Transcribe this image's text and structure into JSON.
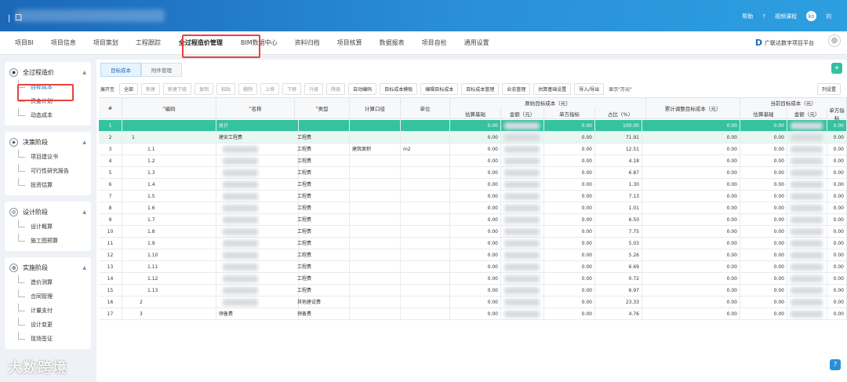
{
  "topbar": {
    "brand": "| 口",
    "help": "帮助",
    "video": "视频课程",
    "avatar": "ko",
    "user": "刘"
  },
  "nav": [
    "项目BI",
    "项目信息",
    "项目策划",
    "工程跟踪",
    "全过程造价管理",
    "BIM数据中心",
    "资料归档",
    "项目核算",
    "数据报表",
    "项目自检",
    "通用设置"
  ],
  "platform": "广联达数字项目平台",
  "sidebar": [
    {
      "title": "全过程造价",
      "items": [
        "目标成本",
        "资金计划",
        "动态成本"
      ]
    },
    {
      "title": "决策阶段",
      "items": [
        "项目建议书",
        "可行性研究报告",
        "投资估算"
      ]
    },
    {
      "title": "设计阶段",
      "items": [
        "设计概算",
        "施工图预算"
      ]
    },
    {
      "title": "实施阶段",
      "items": [
        "造价测算",
        "合同管理",
        "计量支付",
        "设计变更",
        "现场签证"
      ]
    }
  ],
  "tabs": [
    "目标成本",
    "附件管理"
  ],
  "toolbar": {
    "expand_label": "展开至",
    "expand_value": "全部",
    "buttons": [
      "新建",
      "新建下级",
      "复制",
      "粘贴",
      "删除",
      "上移",
      "下移",
      "升级",
      "降级",
      "自动编码",
      "目标成本模板",
      "编辑目标成本",
      "目标成本管理",
      "业态管理",
      "估算基础设置",
      "导入/导出"
    ],
    "show_wan": "显示\"万元\"",
    "col_settings": "列设置"
  },
  "headers": {
    "idx": "#",
    "code": "编码",
    "name": "名称",
    "type": "类型",
    "calc": "计算口径",
    "unit": "单位",
    "orig": "原始目标成本（元）",
    "est_base": "估算基础",
    "amount": "金额（元）",
    "unit_index": "单方指标",
    "ratio": "占比（%）",
    "adjusted": "累计调整目标成本（元）",
    "current": "当前目标成本（元）"
  },
  "rows": [
    {
      "n": "1",
      "code": "",
      "name": "总计",
      "type": "",
      "calc": "",
      "unit": "",
      "base": "0.00",
      "ui": "0.00",
      "ratio": "100.00",
      "adj": "0.00",
      "cb": "0.00",
      "cu": "0.00"
    },
    {
      "n": "2",
      "code": "1",
      "name": "建安工程费",
      "type": "工程费",
      "calc": "",
      "unit": "",
      "base": "0.00",
      "ui": "0.00",
      "ratio": "71.91",
      "adj": "0.00",
      "cb": "0.00",
      "cu": "0.00"
    },
    {
      "n": "3",
      "code": "1.1",
      "name": "",
      "type": "工程费",
      "calc": "建筑面积",
      "unit": "m2",
      "base": "0.00",
      "ui": "0.00",
      "ratio": "12.51",
      "adj": "0.00",
      "cb": "0.00",
      "cu": "0.00"
    },
    {
      "n": "4",
      "code": "1.2",
      "name": "",
      "type": "工程费",
      "calc": "",
      "unit": "",
      "base": "0.00",
      "ui": "0.00",
      "ratio": "4.18",
      "adj": "0.00",
      "cb": "0.00",
      "cu": "0.00"
    },
    {
      "n": "5",
      "code": "1.3",
      "name": "",
      "type": "工程费",
      "calc": "",
      "unit": "",
      "base": "0.00",
      "ui": "0.00",
      "ratio": "6.87",
      "adj": "0.00",
      "cb": "0.00",
      "cu": "0.00"
    },
    {
      "n": "6",
      "code": "1.4",
      "name": "",
      "type": "工程费",
      "calc": "",
      "unit": "",
      "base": "0.00",
      "ui": "0.00",
      "ratio": "1.30",
      "adj": "0.00",
      "cb": "0.00",
      "cu": "0.00"
    },
    {
      "n": "7",
      "code": "1.5",
      "name": "",
      "type": "工程费",
      "calc": "",
      "unit": "",
      "base": "0.00",
      "ui": "0.00",
      "ratio": "7.13",
      "adj": "0.00",
      "cb": "0.00",
      "cu": "0.00"
    },
    {
      "n": "8",
      "code": "1.6",
      "name": "",
      "type": "工程费",
      "calc": "",
      "unit": "",
      "base": "0.00",
      "ui": "0.00",
      "ratio": "1.01",
      "adj": "0.00",
      "cb": "0.00",
      "cu": "0.00"
    },
    {
      "n": "9",
      "code": "1.7",
      "name": "",
      "type": "工程费",
      "calc": "",
      "unit": "",
      "base": "0.00",
      "ui": "0.00",
      "ratio": "6.50",
      "adj": "0.00",
      "cb": "0.00",
      "cu": "0.00"
    },
    {
      "n": "10",
      "code": "1.8",
      "name": "",
      "type": "工程费",
      "calc": "",
      "unit": "",
      "base": "0.00",
      "ui": "0.00",
      "ratio": "7.75",
      "adj": "0.00",
      "cb": "0.00",
      "cu": "0.00"
    },
    {
      "n": "11",
      "code": "1.9",
      "name": "",
      "type": "工程费",
      "calc": "",
      "unit": "",
      "base": "0.00",
      "ui": "0.00",
      "ratio": "5.03",
      "adj": "0.00",
      "cb": "0.00",
      "cu": "0.00"
    },
    {
      "n": "12",
      "code": "1.10",
      "name": "",
      "type": "工程费",
      "calc": "",
      "unit": "",
      "base": "0.00",
      "ui": "0.00",
      "ratio": "5.26",
      "adj": "0.00",
      "cb": "0.00",
      "cu": "0.00"
    },
    {
      "n": "13",
      "code": "1.11",
      "name": "",
      "type": "工程费",
      "calc": "",
      "unit": "",
      "base": "0.00",
      "ui": "0.00",
      "ratio": "6.69",
      "adj": "0.00",
      "cb": "0.00",
      "cu": "0.00"
    },
    {
      "n": "14",
      "code": "1.12",
      "name": "",
      "type": "工程费",
      "calc": "",
      "unit": "",
      "base": "0.00",
      "ui": "0.00",
      "ratio": "0.72",
      "adj": "0.00",
      "cb": "0.00",
      "cu": "0.00"
    },
    {
      "n": "15",
      "code": "1.13",
      "name": "",
      "type": "工程费",
      "calc": "",
      "unit": "",
      "base": "0.00",
      "ui": "0.00",
      "ratio": "6.97",
      "adj": "0.00",
      "cb": "0.00",
      "cu": "0.00"
    },
    {
      "n": "16",
      "code": "2",
      "name": "",
      "type": "其他建设费",
      "calc": "",
      "unit": "",
      "base": "0.00",
      "ui": "0.00",
      "ratio": "23.33",
      "adj": "0.00",
      "cb": "0.00",
      "cu": "0.00"
    },
    {
      "n": "17",
      "code": "3",
      "name": "预备费",
      "type": "预备费",
      "calc": "",
      "unit": "",
      "base": "0.00",
      "ui": "0.00",
      "ratio": "4.76",
      "adj": "0.00",
      "cb": "0.00",
      "cu": "0.00"
    }
  ],
  "watermark": "大数跨境"
}
